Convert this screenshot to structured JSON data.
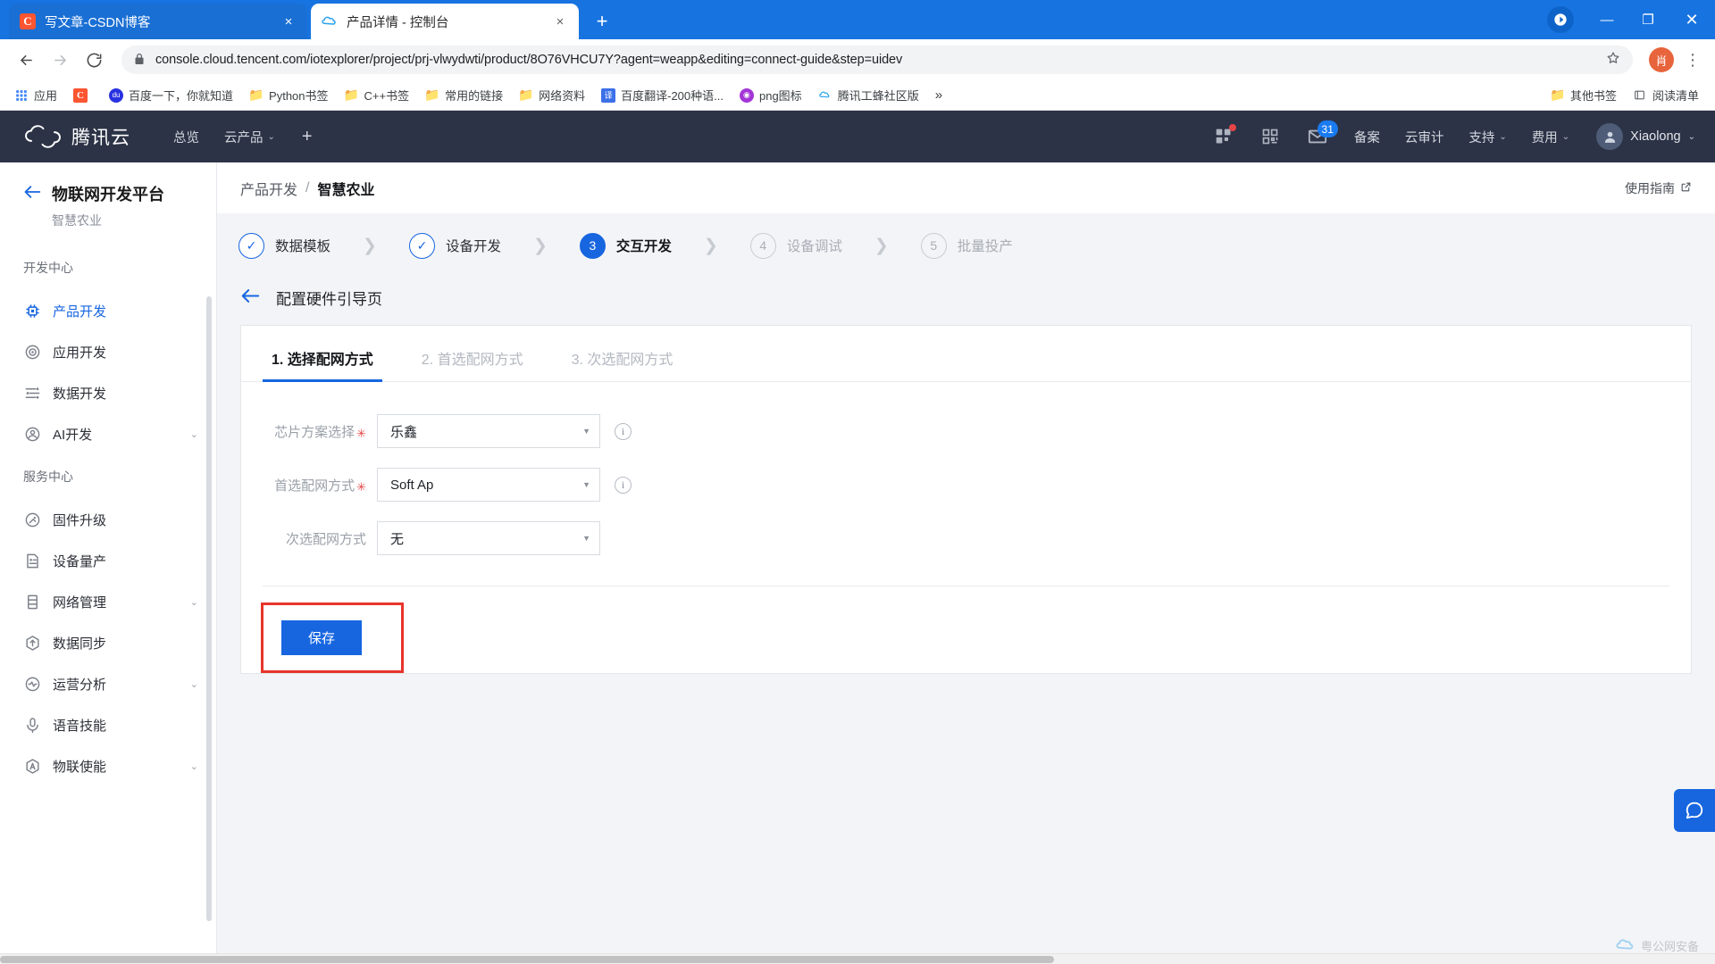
{
  "browser": {
    "tabs": [
      {
        "title": "写文章-CSDN博客",
        "favicon": "csdn-icon",
        "favicon_char": "C",
        "active": false,
        "close_label": "×"
      },
      {
        "title": "产品详情 - 控制台",
        "favicon": "tencent-cloud-icon",
        "active": true,
        "close_label": "×"
      }
    ],
    "new_tab_label": "+",
    "window_controls": {
      "minimize": "—",
      "maximize": "❐",
      "close": "✕",
      "profile_initial": ""
    },
    "toolbar": {
      "back_icon": "back-arrow-icon",
      "forward_icon": "forward-arrow-icon",
      "reload_icon": "reload-icon",
      "lock_icon": "lock-icon",
      "url_host": "console.cloud.tencent.com",
      "url_path": "/iotexplorer/project/prj-vlwydwti/product/8O76VHCU7Y?agent=weapp&editing=connect-guide&step=uidev",
      "url_full": "console.cloud.tencent.com/iotexplorer/project/prj-vlwydwti/product/8O76VHCU7Y?agent=weapp&editing=connect-guide&step=uidev",
      "star_icon": "star-icon",
      "avatar_initial": "肖",
      "menu_icon": "kebab-menu-icon"
    },
    "bookmarks": [
      {
        "label": "应用",
        "icon": "apps-grid-icon"
      },
      {
        "label": "",
        "icon": "csdn-icon",
        "icon_char": "C"
      },
      {
        "label": "百度一下，你就知道",
        "icon": "baidu-icon",
        "icon_char": "du"
      },
      {
        "label": "Python书签",
        "icon": "folder-icon"
      },
      {
        "label": "C++书签",
        "icon": "folder-icon"
      },
      {
        "label": "常用的链接",
        "icon": "folder-icon"
      },
      {
        "label": "网络资料",
        "icon": "folder-icon"
      },
      {
        "label": "百度翻译-200种语...",
        "icon": "fanyi-icon",
        "icon_char": "译"
      },
      {
        "label": "png图标",
        "icon": "png-icon",
        "icon_char": "◉"
      },
      {
        "label": "腾讯工蜂社区版",
        "icon": "tencent-icon"
      }
    ],
    "bookmarks_overflow": "»",
    "bookmarks_right": [
      {
        "label": "其他书签",
        "icon": "folder-icon"
      },
      {
        "label": "阅读清单",
        "icon": "reading-list-icon"
      }
    ]
  },
  "cloud_nav": {
    "logo_text": "腾讯云",
    "items": [
      {
        "label": "总览",
        "caret": false
      },
      {
        "label": "云产品",
        "caret": true
      }
    ],
    "plus_label": "+",
    "icons": [
      {
        "name": "dashboard-grid-icon",
        "badge": "dot"
      },
      {
        "name": "qr-code-icon",
        "badge": ""
      },
      {
        "name": "mail-icon",
        "badge": "31"
      }
    ],
    "right_items": [
      {
        "label": "备案",
        "caret": false
      },
      {
        "label": "云审计",
        "caret": false
      },
      {
        "label": "支持",
        "caret": true
      },
      {
        "label": "费用",
        "caret": true
      }
    ],
    "user": {
      "name": "Xiaolong",
      "avatar_icon": "user-avatar-icon",
      "caret": "⌄"
    }
  },
  "sidebar": {
    "back_icon": "back-arrow-icon",
    "title": "物联网开发平台",
    "subtitle": "智慧农业",
    "groups": [
      {
        "label": "开发中心",
        "items": [
          {
            "label": "产品开发",
            "icon": "chip-icon",
            "active": true,
            "caret": false
          },
          {
            "label": "应用开发",
            "icon": "app-circle-icon",
            "active": false,
            "caret": false
          },
          {
            "label": "数据开发",
            "icon": "data-flow-icon",
            "active": false,
            "caret": false
          },
          {
            "label": "AI开发",
            "icon": "ai-circle-icon",
            "active": false,
            "caret": true
          }
        ]
      },
      {
        "label": "服务中心",
        "items": [
          {
            "label": "固件升级",
            "icon": "firmware-upgrade-icon",
            "active": false,
            "caret": false
          },
          {
            "label": "设备量产",
            "icon": "device-batch-icon",
            "active": false,
            "caret": false
          },
          {
            "label": "网络管理",
            "icon": "network-manage-icon",
            "active": false,
            "caret": true
          },
          {
            "label": "数据同步",
            "icon": "data-sync-icon",
            "active": false,
            "caret": false
          },
          {
            "label": "运营分析",
            "icon": "analytics-icon",
            "active": false,
            "caret": true
          },
          {
            "label": "语音技能",
            "icon": "voice-skill-icon",
            "active": false,
            "caret": false
          },
          {
            "label": "物联使能",
            "icon": "iot-enable-icon",
            "active": false,
            "caret": true
          }
        ]
      }
    ]
  },
  "main": {
    "breadcrumb": {
      "parent": "产品开发",
      "separator": "/",
      "current": "智慧农业"
    },
    "guide_link": {
      "label": "使用指南",
      "icon": "external-link-icon"
    },
    "steps": [
      {
        "num": "1",
        "label": "数据模板",
        "state": "done",
        "mark": "✓"
      },
      {
        "num": "2",
        "label": "设备开发",
        "state": "done",
        "mark": "✓"
      },
      {
        "num": "3",
        "label": "交互开发",
        "state": "current",
        "mark": "3"
      },
      {
        "num": "4",
        "label": "设备调试",
        "state": "todo",
        "mark": "4"
      },
      {
        "num": "5",
        "label": "批量投产",
        "state": "todo",
        "mark": "5"
      }
    ],
    "step_arrow": "❯",
    "subhead": {
      "back_icon": "back-arrow-icon",
      "title": "配置硬件引导页"
    },
    "card_tabs": [
      {
        "label": "1. 选择配网方式",
        "active": true
      },
      {
        "label": "2. 首选配网方式",
        "active": false
      },
      {
        "label": "3. 次选配网方式",
        "active": false
      }
    ],
    "form": {
      "fields": [
        {
          "label": "芯片方案选择",
          "required": true,
          "value": "乐鑫",
          "has_info": true,
          "caret": "▼"
        },
        {
          "label": "首选配网方式",
          "required": true,
          "value": "Soft Ap",
          "has_info": true,
          "caret": "▼"
        },
        {
          "label": "次选配网方式",
          "required": false,
          "value": "无",
          "has_info": false,
          "caret": "▼"
        }
      ],
      "required_mark": "✳",
      "info_icon_char": "i",
      "save_label": "保存",
      "save_highlight_color": "#e8342a"
    },
    "chat_icon": "chat-bubble-icon",
    "watermark": {
      "text": "粤公网安备",
      "icon": "watermark-icon"
    }
  },
  "colors": {
    "brand_blue": "#1766e0",
    "nav_dark": "#2c3346",
    "tab_blue": "#1773e0",
    "page_bg": "#f3f4f7",
    "required_red": "#e54545",
    "highlight_red": "#e8342a"
  }
}
